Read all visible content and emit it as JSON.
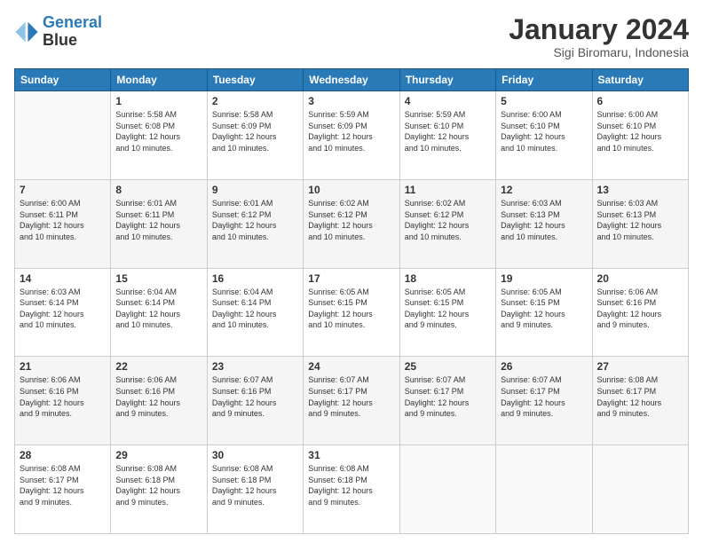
{
  "logo": {
    "line1": "General",
    "line2": "Blue"
  },
  "header": {
    "title": "January 2024",
    "subtitle": "Sigi Biromaru, Indonesia"
  },
  "weekdays": [
    "Sunday",
    "Monday",
    "Tuesday",
    "Wednesday",
    "Thursday",
    "Friday",
    "Saturday"
  ],
  "weeks": [
    [
      {
        "day": "",
        "info": ""
      },
      {
        "day": "1",
        "info": "Sunrise: 5:58 AM\nSunset: 6:08 PM\nDaylight: 12 hours\nand 10 minutes."
      },
      {
        "day": "2",
        "info": "Sunrise: 5:58 AM\nSunset: 6:09 PM\nDaylight: 12 hours\nand 10 minutes."
      },
      {
        "day": "3",
        "info": "Sunrise: 5:59 AM\nSunset: 6:09 PM\nDaylight: 12 hours\nand 10 minutes."
      },
      {
        "day": "4",
        "info": "Sunrise: 5:59 AM\nSunset: 6:10 PM\nDaylight: 12 hours\nand 10 minutes."
      },
      {
        "day": "5",
        "info": "Sunrise: 6:00 AM\nSunset: 6:10 PM\nDaylight: 12 hours\nand 10 minutes."
      },
      {
        "day": "6",
        "info": "Sunrise: 6:00 AM\nSunset: 6:10 PM\nDaylight: 12 hours\nand 10 minutes."
      }
    ],
    [
      {
        "day": "7",
        "info": "Sunrise: 6:00 AM\nSunset: 6:11 PM\nDaylight: 12 hours\nand 10 minutes."
      },
      {
        "day": "8",
        "info": "Sunrise: 6:01 AM\nSunset: 6:11 PM\nDaylight: 12 hours\nand 10 minutes."
      },
      {
        "day": "9",
        "info": "Sunrise: 6:01 AM\nSunset: 6:12 PM\nDaylight: 12 hours\nand 10 minutes."
      },
      {
        "day": "10",
        "info": "Sunrise: 6:02 AM\nSunset: 6:12 PM\nDaylight: 12 hours\nand 10 minutes."
      },
      {
        "day": "11",
        "info": "Sunrise: 6:02 AM\nSunset: 6:12 PM\nDaylight: 12 hours\nand 10 minutes."
      },
      {
        "day": "12",
        "info": "Sunrise: 6:03 AM\nSunset: 6:13 PM\nDaylight: 12 hours\nand 10 minutes."
      },
      {
        "day": "13",
        "info": "Sunrise: 6:03 AM\nSunset: 6:13 PM\nDaylight: 12 hours\nand 10 minutes."
      }
    ],
    [
      {
        "day": "14",
        "info": "Sunrise: 6:03 AM\nSunset: 6:14 PM\nDaylight: 12 hours\nand 10 minutes."
      },
      {
        "day": "15",
        "info": "Sunrise: 6:04 AM\nSunset: 6:14 PM\nDaylight: 12 hours\nand 10 minutes."
      },
      {
        "day": "16",
        "info": "Sunrise: 6:04 AM\nSunset: 6:14 PM\nDaylight: 12 hours\nand 10 minutes."
      },
      {
        "day": "17",
        "info": "Sunrise: 6:05 AM\nSunset: 6:15 PM\nDaylight: 12 hours\nand 10 minutes."
      },
      {
        "day": "18",
        "info": "Sunrise: 6:05 AM\nSunset: 6:15 PM\nDaylight: 12 hours\nand 9 minutes."
      },
      {
        "day": "19",
        "info": "Sunrise: 6:05 AM\nSunset: 6:15 PM\nDaylight: 12 hours\nand 9 minutes."
      },
      {
        "day": "20",
        "info": "Sunrise: 6:06 AM\nSunset: 6:16 PM\nDaylight: 12 hours\nand 9 minutes."
      }
    ],
    [
      {
        "day": "21",
        "info": "Sunrise: 6:06 AM\nSunset: 6:16 PM\nDaylight: 12 hours\nand 9 minutes."
      },
      {
        "day": "22",
        "info": "Sunrise: 6:06 AM\nSunset: 6:16 PM\nDaylight: 12 hours\nand 9 minutes."
      },
      {
        "day": "23",
        "info": "Sunrise: 6:07 AM\nSunset: 6:16 PM\nDaylight: 12 hours\nand 9 minutes."
      },
      {
        "day": "24",
        "info": "Sunrise: 6:07 AM\nSunset: 6:17 PM\nDaylight: 12 hours\nand 9 minutes."
      },
      {
        "day": "25",
        "info": "Sunrise: 6:07 AM\nSunset: 6:17 PM\nDaylight: 12 hours\nand 9 minutes."
      },
      {
        "day": "26",
        "info": "Sunrise: 6:07 AM\nSunset: 6:17 PM\nDaylight: 12 hours\nand 9 minutes."
      },
      {
        "day": "27",
        "info": "Sunrise: 6:08 AM\nSunset: 6:17 PM\nDaylight: 12 hours\nand 9 minutes."
      }
    ],
    [
      {
        "day": "28",
        "info": "Sunrise: 6:08 AM\nSunset: 6:17 PM\nDaylight: 12 hours\nand 9 minutes."
      },
      {
        "day": "29",
        "info": "Sunrise: 6:08 AM\nSunset: 6:18 PM\nDaylight: 12 hours\nand 9 minutes."
      },
      {
        "day": "30",
        "info": "Sunrise: 6:08 AM\nSunset: 6:18 PM\nDaylight: 12 hours\nand 9 minutes."
      },
      {
        "day": "31",
        "info": "Sunrise: 6:08 AM\nSunset: 6:18 PM\nDaylight: 12 hours\nand 9 minutes."
      },
      {
        "day": "",
        "info": ""
      },
      {
        "day": "",
        "info": ""
      },
      {
        "day": "",
        "info": ""
      }
    ]
  ]
}
